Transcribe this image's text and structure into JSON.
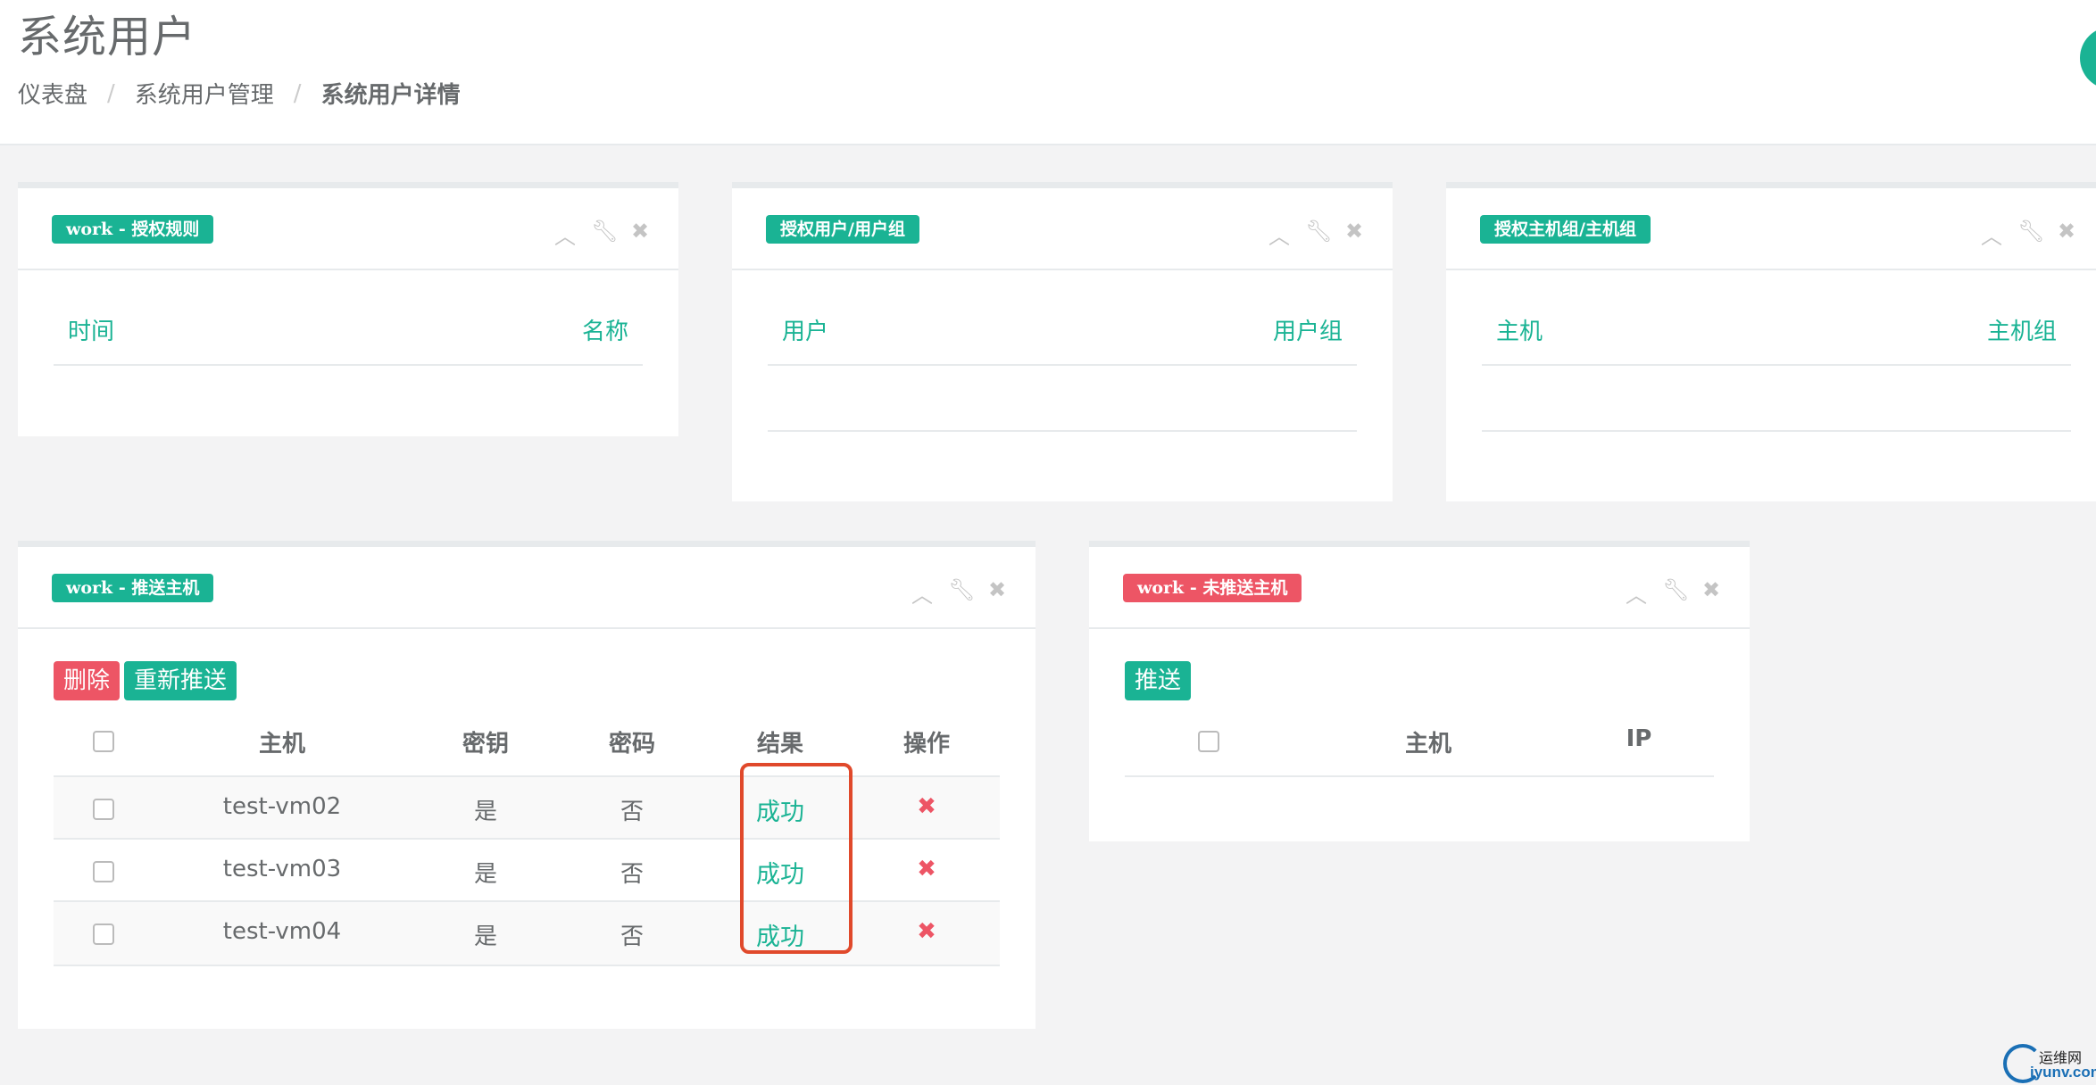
{
  "page": {
    "title": "系统用户"
  },
  "breadcrumb": {
    "items": [
      "仪表盘",
      "系统用户管理",
      "系统用户详情"
    ],
    "separator": "/"
  },
  "colors": {
    "accent": "#1ab394",
    "danger": "#ed5565",
    "highlight": "#e0492b"
  },
  "panel_tools": {
    "collapse": "chevron-up-icon",
    "settings": "wrench-icon",
    "close": "close-icon"
  },
  "rules_panel": {
    "label": "work - 授权规则",
    "col1": "时间",
    "col2": "名称"
  },
  "users_panel": {
    "label": "授权用户/用户组",
    "col1": "用户",
    "col2": "用户组"
  },
  "hosts_panel": {
    "label": "授权主机组/主机组",
    "col1": "主机",
    "col2": "主机组"
  },
  "pushed_panel": {
    "label": "work - 推送主机",
    "delete_button": "删除",
    "repush_button": "重新推送",
    "columns": [
      "主机",
      "密钥",
      "密码",
      "结果",
      "操作"
    ],
    "rows": [
      {
        "host": "test-vm02",
        "key": "是",
        "password": "否",
        "result": "成功"
      },
      {
        "host": "test-vm03",
        "key": "是",
        "password": "否",
        "result": "成功"
      },
      {
        "host": "test-vm04",
        "key": "是",
        "password": "否",
        "result": "成功"
      }
    ]
  },
  "unpushed_panel": {
    "label": "work - 未推送主机",
    "push_button": "推送",
    "columns": [
      "主机",
      "IP"
    ]
  },
  "watermark": {
    "line1": "运维网",
    "line2": "iyunv.com"
  }
}
